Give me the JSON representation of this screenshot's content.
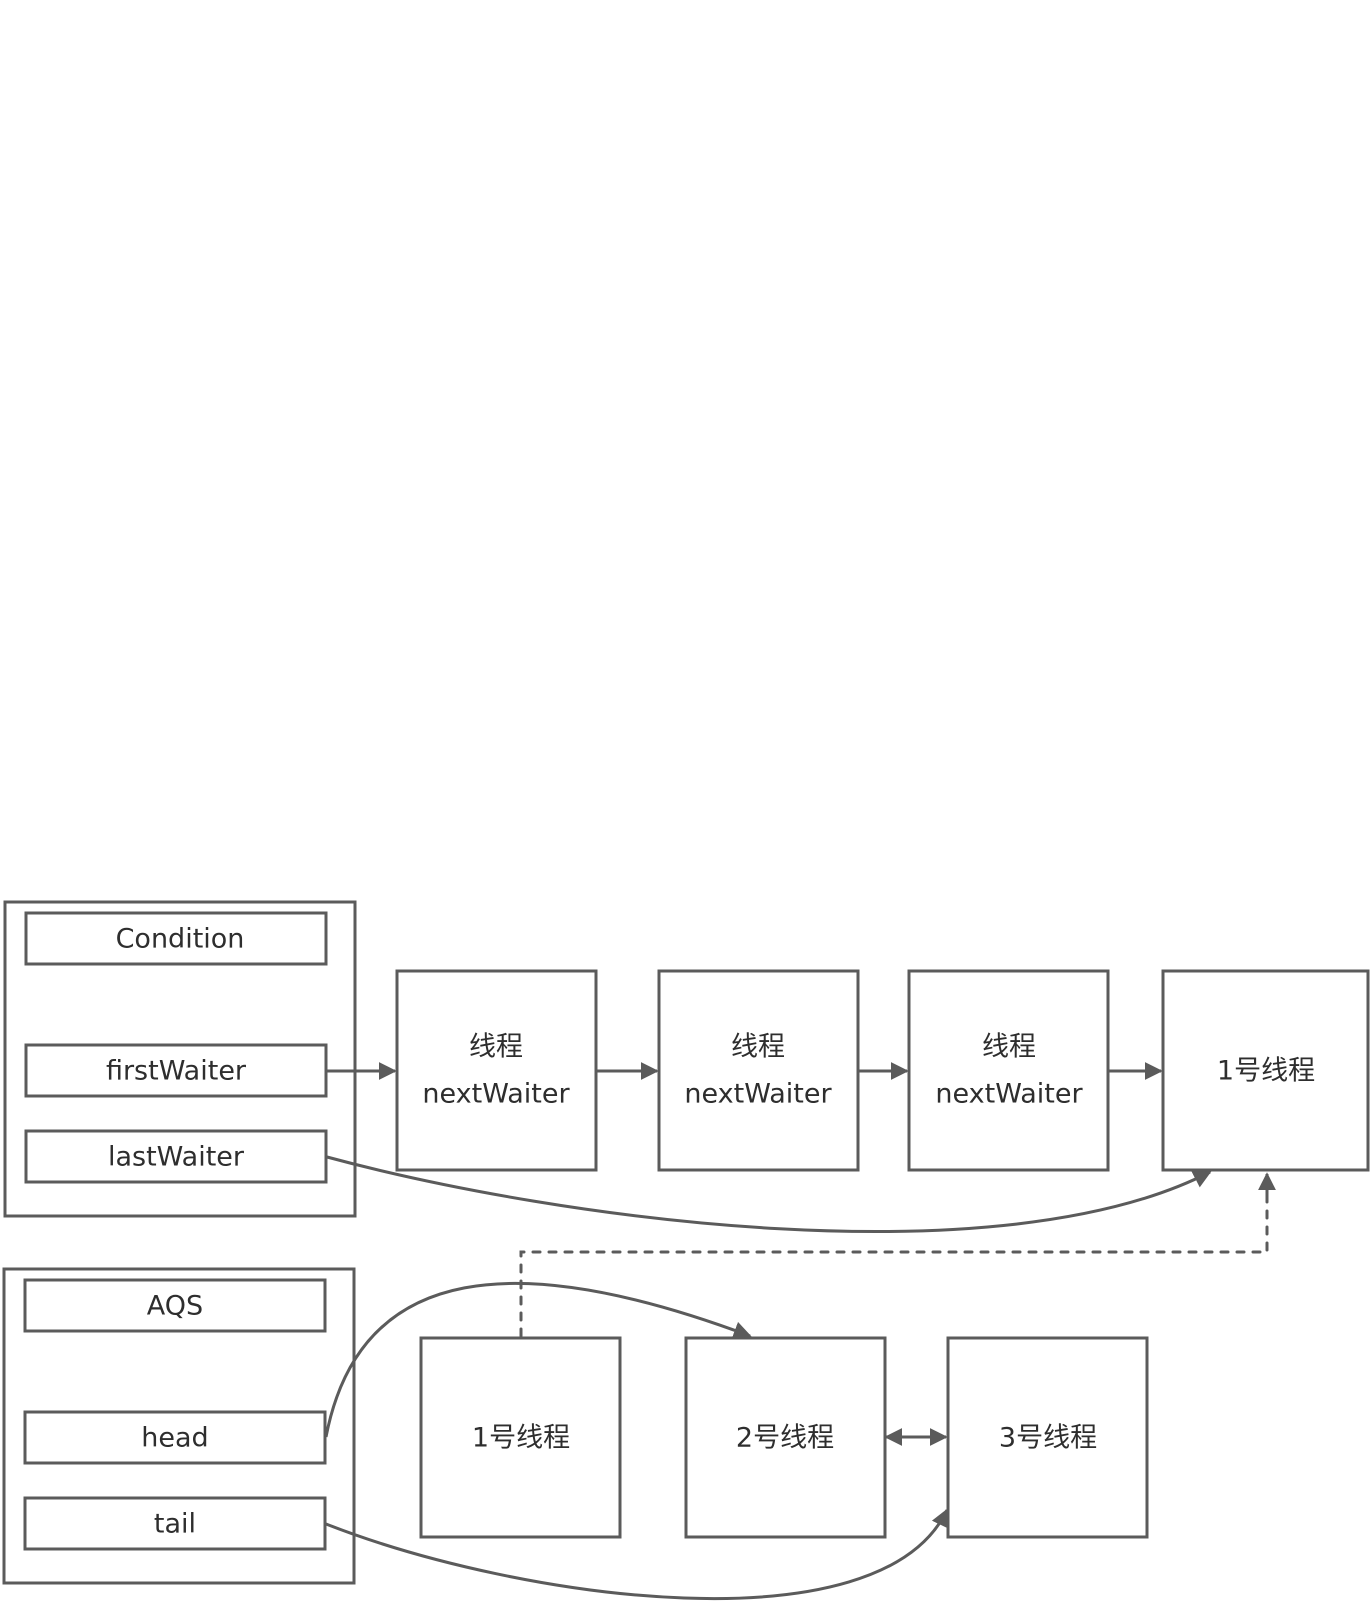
{
  "condition": {
    "title": "Condition",
    "fields": [
      "firstWaiter",
      "lastWaiter"
    ]
  },
  "aqs": {
    "title": "AQS",
    "fields": [
      "head",
      "tail"
    ]
  },
  "condition_queue": [
    {
      "line1": "线程",
      "line2": "nextWaiter"
    },
    {
      "line1": "线程",
      "line2": "nextWaiter"
    },
    {
      "line1": "线程",
      "line2": "nextWaiter"
    },
    {
      "line1": "1号线程",
      "line2": ""
    }
  ],
  "sync_queue": [
    "1号线程",
    "2号线程",
    "3号线程"
  ],
  "colors": {
    "stroke": "#5b5b5b",
    "text": "#2e2e2e"
  }
}
